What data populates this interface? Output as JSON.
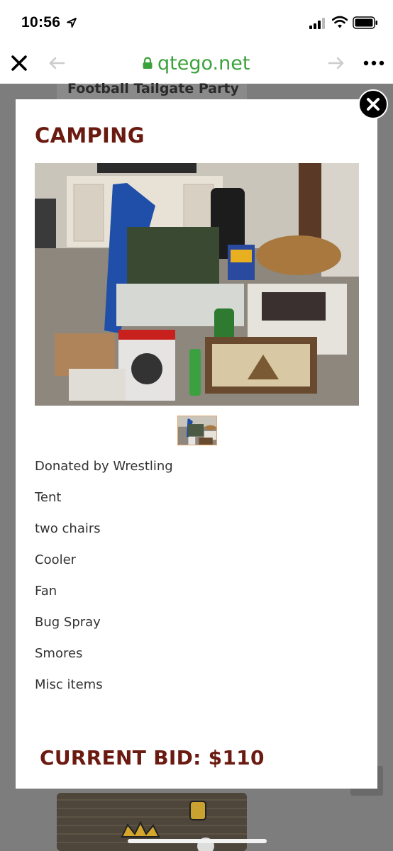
{
  "status_bar": {
    "time": "10:56"
  },
  "browser": {
    "url": "qtego.net"
  },
  "background_page": {
    "title": "Football Tailgate Party"
  },
  "modal": {
    "title": "CAMPING",
    "description_lines": [
      "Donated by Wrestling",
      "Tent",
      "two chairs",
      "Cooler",
      "Fan",
      "Bug Spray",
      "Smores",
      "Misc items"
    ],
    "current_bid": "CURRENT BID: $110"
  },
  "colors": {
    "accent": "#6a1a10",
    "url_green": "#3aa23a",
    "thumb_border": "#e3a46a"
  }
}
